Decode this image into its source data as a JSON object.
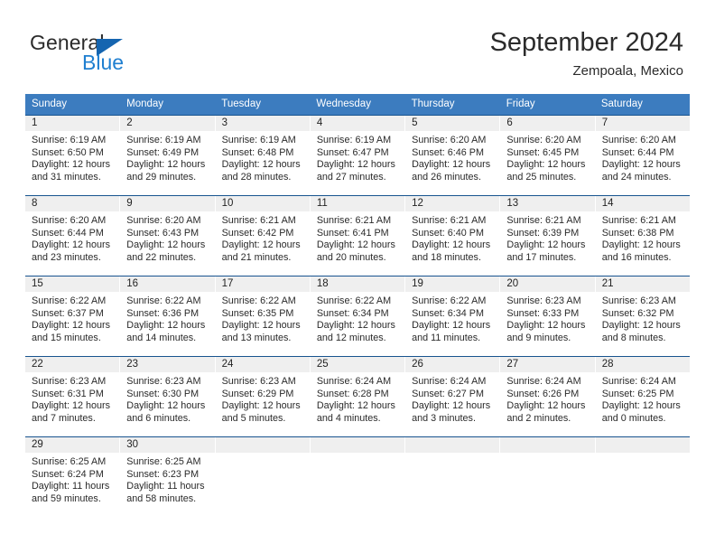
{
  "brand": {
    "name_part1": "General",
    "name_part2": "Blue",
    "color_dark": "#2b2b2b",
    "color_blue": "#1f7fd0",
    "triangle_color": "#1565b0"
  },
  "header": {
    "title": "September 2024",
    "subtitle": "Zempoala, Mexico"
  },
  "theme": {
    "header_row_bg": "#3c7cbf",
    "header_row_text": "#ffffff",
    "week_divider": "#18548f",
    "daynum_strip_bg": "#efefef",
    "page_bg": "#ffffff"
  },
  "weekdays": [
    "Sunday",
    "Monday",
    "Tuesday",
    "Wednesday",
    "Thursday",
    "Friday",
    "Saturday"
  ],
  "weeks": [
    [
      {
        "day": "1",
        "sunrise": "Sunrise: 6:19 AM",
        "sunset": "Sunset: 6:50 PM",
        "daylight1": "Daylight: 12 hours",
        "daylight2": "and 31 minutes."
      },
      {
        "day": "2",
        "sunrise": "Sunrise: 6:19 AM",
        "sunset": "Sunset: 6:49 PM",
        "daylight1": "Daylight: 12 hours",
        "daylight2": "and 29 minutes."
      },
      {
        "day": "3",
        "sunrise": "Sunrise: 6:19 AM",
        "sunset": "Sunset: 6:48 PM",
        "daylight1": "Daylight: 12 hours",
        "daylight2": "and 28 minutes."
      },
      {
        "day": "4",
        "sunrise": "Sunrise: 6:19 AM",
        "sunset": "Sunset: 6:47 PM",
        "daylight1": "Daylight: 12 hours",
        "daylight2": "and 27 minutes."
      },
      {
        "day": "5",
        "sunrise": "Sunrise: 6:20 AM",
        "sunset": "Sunset: 6:46 PM",
        "daylight1": "Daylight: 12 hours",
        "daylight2": "and 26 minutes."
      },
      {
        "day": "6",
        "sunrise": "Sunrise: 6:20 AM",
        "sunset": "Sunset: 6:45 PM",
        "daylight1": "Daylight: 12 hours",
        "daylight2": "and 25 minutes."
      },
      {
        "day": "7",
        "sunrise": "Sunrise: 6:20 AM",
        "sunset": "Sunset: 6:44 PM",
        "daylight1": "Daylight: 12 hours",
        "daylight2": "and 24 minutes."
      }
    ],
    [
      {
        "day": "8",
        "sunrise": "Sunrise: 6:20 AM",
        "sunset": "Sunset: 6:44 PM",
        "daylight1": "Daylight: 12 hours",
        "daylight2": "and 23 minutes."
      },
      {
        "day": "9",
        "sunrise": "Sunrise: 6:20 AM",
        "sunset": "Sunset: 6:43 PM",
        "daylight1": "Daylight: 12 hours",
        "daylight2": "and 22 minutes."
      },
      {
        "day": "10",
        "sunrise": "Sunrise: 6:21 AM",
        "sunset": "Sunset: 6:42 PM",
        "daylight1": "Daylight: 12 hours",
        "daylight2": "and 21 minutes."
      },
      {
        "day": "11",
        "sunrise": "Sunrise: 6:21 AM",
        "sunset": "Sunset: 6:41 PM",
        "daylight1": "Daylight: 12 hours",
        "daylight2": "and 20 minutes."
      },
      {
        "day": "12",
        "sunrise": "Sunrise: 6:21 AM",
        "sunset": "Sunset: 6:40 PM",
        "daylight1": "Daylight: 12 hours",
        "daylight2": "and 18 minutes."
      },
      {
        "day": "13",
        "sunrise": "Sunrise: 6:21 AM",
        "sunset": "Sunset: 6:39 PM",
        "daylight1": "Daylight: 12 hours",
        "daylight2": "and 17 minutes."
      },
      {
        "day": "14",
        "sunrise": "Sunrise: 6:21 AM",
        "sunset": "Sunset: 6:38 PM",
        "daylight1": "Daylight: 12 hours",
        "daylight2": "and 16 minutes."
      }
    ],
    [
      {
        "day": "15",
        "sunrise": "Sunrise: 6:22 AM",
        "sunset": "Sunset: 6:37 PM",
        "daylight1": "Daylight: 12 hours",
        "daylight2": "and 15 minutes."
      },
      {
        "day": "16",
        "sunrise": "Sunrise: 6:22 AM",
        "sunset": "Sunset: 6:36 PM",
        "daylight1": "Daylight: 12 hours",
        "daylight2": "and 14 minutes."
      },
      {
        "day": "17",
        "sunrise": "Sunrise: 6:22 AM",
        "sunset": "Sunset: 6:35 PM",
        "daylight1": "Daylight: 12 hours",
        "daylight2": "and 13 minutes."
      },
      {
        "day": "18",
        "sunrise": "Sunrise: 6:22 AM",
        "sunset": "Sunset: 6:34 PM",
        "daylight1": "Daylight: 12 hours",
        "daylight2": "and 12 minutes."
      },
      {
        "day": "19",
        "sunrise": "Sunrise: 6:22 AM",
        "sunset": "Sunset: 6:34 PM",
        "daylight1": "Daylight: 12 hours",
        "daylight2": "and 11 minutes."
      },
      {
        "day": "20",
        "sunrise": "Sunrise: 6:23 AM",
        "sunset": "Sunset: 6:33 PM",
        "daylight1": "Daylight: 12 hours",
        "daylight2": "and 9 minutes."
      },
      {
        "day": "21",
        "sunrise": "Sunrise: 6:23 AM",
        "sunset": "Sunset: 6:32 PM",
        "daylight1": "Daylight: 12 hours",
        "daylight2": "and 8 minutes."
      }
    ],
    [
      {
        "day": "22",
        "sunrise": "Sunrise: 6:23 AM",
        "sunset": "Sunset: 6:31 PM",
        "daylight1": "Daylight: 12 hours",
        "daylight2": "and 7 minutes."
      },
      {
        "day": "23",
        "sunrise": "Sunrise: 6:23 AM",
        "sunset": "Sunset: 6:30 PM",
        "daylight1": "Daylight: 12 hours",
        "daylight2": "and 6 minutes."
      },
      {
        "day": "24",
        "sunrise": "Sunrise: 6:23 AM",
        "sunset": "Sunset: 6:29 PM",
        "daylight1": "Daylight: 12 hours",
        "daylight2": "and 5 minutes."
      },
      {
        "day": "25",
        "sunrise": "Sunrise: 6:24 AM",
        "sunset": "Sunset: 6:28 PM",
        "daylight1": "Daylight: 12 hours",
        "daylight2": "and 4 minutes."
      },
      {
        "day": "26",
        "sunrise": "Sunrise: 6:24 AM",
        "sunset": "Sunset: 6:27 PM",
        "daylight1": "Daylight: 12 hours",
        "daylight2": "and 3 minutes."
      },
      {
        "day": "27",
        "sunrise": "Sunrise: 6:24 AM",
        "sunset": "Sunset: 6:26 PM",
        "daylight1": "Daylight: 12 hours",
        "daylight2": "and 2 minutes."
      },
      {
        "day": "28",
        "sunrise": "Sunrise: 6:24 AM",
        "sunset": "Sunset: 6:25 PM",
        "daylight1": "Daylight: 12 hours",
        "daylight2": "and 0 minutes."
      }
    ],
    [
      {
        "day": "29",
        "sunrise": "Sunrise: 6:25 AM",
        "sunset": "Sunset: 6:24 PM",
        "daylight1": "Daylight: 11 hours",
        "daylight2": "and 59 minutes."
      },
      {
        "day": "30",
        "sunrise": "Sunrise: 6:25 AM",
        "sunset": "Sunset: 6:23 PM",
        "daylight1": "Daylight: 11 hours",
        "daylight2": "and 58 minutes."
      },
      {
        "day": "",
        "sunrise": "",
        "sunset": "",
        "daylight1": "",
        "daylight2": ""
      },
      {
        "day": "",
        "sunrise": "",
        "sunset": "",
        "daylight1": "",
        "daylight2": ""
      },
      {
        "day": "",
        "sunrise": "",
        "sunset": "",
        "daylight1": "",
        "daylight2": ""
      },
      {
        "day": "",
        "sunrise": "",
        "sunset": "",
        "daylight1": "",
        "daylight2": ""
      },
      {
        "day": "",
        "sunrise": "",
        "sunset": "",
        "daylight1": "",
        "daylight2": ""
      }
    ]
  ]
}
